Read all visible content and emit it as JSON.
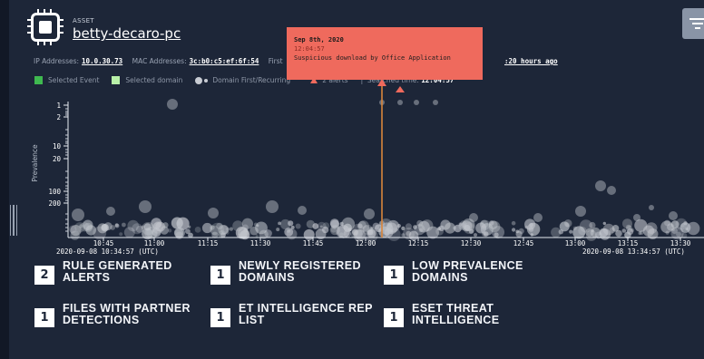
{
  "asset": {
    "label": "ASSET",
    "name": "betty-decaro-pc"
  },
  "meta": {
    "ip_label": "IP Addresses:",
    "ip_value": "10.0.30.73",
    "mac_label": "MAC Addresses:",
    "mac_value": "3c:b0:c5:ef:6f:54",
    "first_label": "First",
    "last_value": "20 hours ago",
    "last_prefix": ":"
  },
  "legend": {
    "selected_event": "Selected Event",
    "selected_domain": "Selected domain",
    "domain_first": "Domain First/Recurring",
    "alerts": "2 alerts",
    "search_prefix": "Search",
    "search_hidden": "ed time:",
    "search_time": "12:04:57",
    "colors": {
      "selected_event": "#3fb950",
      "selected_domain": "#b8f0a8",
      "alert": "#ef6a5d"
    }
  },
  "tooltip": {
    "date": "Sep 8th, 2020",
    "time": "12:04:57",
    "message": "Suspicious download by Office Application"
  },
  "chart": {
    "y_axis_label": "Prevalence",
    "y_ticks": [
      "1",
      "2",
      "10",
      "20",
      "100",
      "200"
    ],
    "x_ticks": [
      "10:45",
      "11:00",
      "11:15",
      "11:30",
      "11:45",
      "12:00",
      "12:15",
      "12:30",
      "12:45",
      "13:00",
      "13:15",
      "13:30"
    ],
    "start_label": "2020-09-08 10:34:57 (UTC)",
    "end_label": "2020-09-08 13:34:57 (UTC)",
    "selected_time": "12:04:57",
    "accent": "#d9853b"
  },
  "chart_data": {
    "type": "scatter",
    "ylabel": "Prevalence",
    "yscale": "log",
    "x_range": [
      "2020-09-08 10:34:57",
      "2020-09-08 13:34:57"
    ],
    "alerts": [
      "12:04:57",
      "12:10:30"
    ],
    "selected_event": "12:04:57"
  },
  "cards": [
    {
      "count": "2",
      "label": "RULE GENERATED ALERTS"
    },
    {
      "count": "1",
      "label": "NEWLY REGISTERED DOMAINS"
    },
    {
      "count": "1",
      "label": "LOW PREVALENCE DOMAINS"
    },
    {
      "count": "1",
      "label": "FILES WITH PARTNER DETECTIONS"
    },
    {
      "count": "1",
      "label": "ET INTELLIGENCE REP LIST"
    },
    {
      "count": "1",
      "label": "ESET THREAT INTELLIGENCE"
    }
  ],
  "filter": {
    "icon": "filter-icon"
  }
}
